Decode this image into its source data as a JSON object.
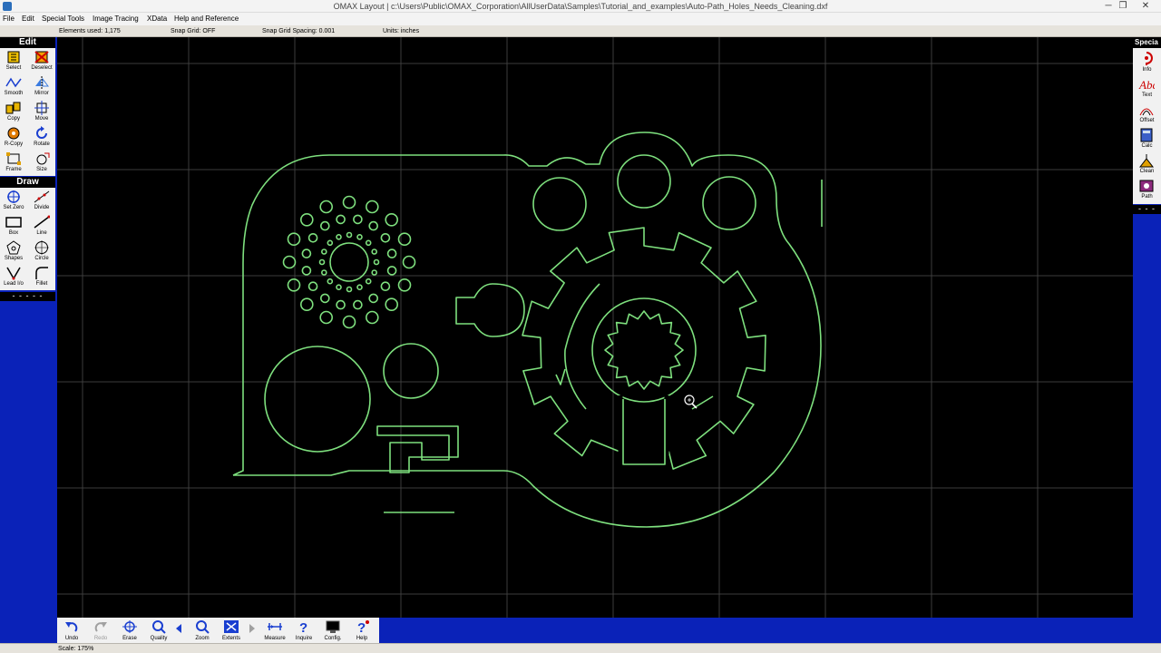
{
  "window": {
    "title": "OMAX Layout | c:\\Users\\Public\\OMAX_Corporation\\AllUserData\\Samples\\Tutorial_and_examples\\Auto-Path_Holes_Needs_Cleaning.dxf",
    "minimize": "─",
    "maximize": "❐",
    "close": "✕"
  },
  "menu": [
    "File",
    "Edit",
    "Special Tools",
    "Image Tracing",
    "XData",
    "Help and Reference"
  ],
  "status": {
    "elements_used": "Elements used: 1,175",
    "snap_grid": "Snap Grid: OFF",
    "snap_spacing": "Snap Grid Spacing: 0.001",
    "units": "Units: inches"
  },
  "edit_palette": {
    "title": "Edit",
    "tools": [
      {
        "label": "Select",
        "icon": "select-icon"
      },
      {
        "label": "Deselect",
        "icon": "deselect-icon"
      },
      {
        "label": "Smooth",
        "icon": "smooth-icon"
      },
      {
        "label": "Mirror",
        "icon": "mirror-icon"
      },
      {
        "label": "Copy",
        "icon": "copy-icon"
      },
      {
        "label": "Move",
        "icon": "move-icon"
      },
      {
        "label": "R-Copy",
        "icon": "rotate-copy-icon"
      },
      {
        "label": "Rotate",
        "icon": "rotate-icon"
      },
      {
        "label": "Frame",
        "icon": "frame-icon"
      },
      {
        "label": "Size",
        "icon": "size-icon"
      }
    ]
  },
  "draw_palette": {
    "title": "Draw",
    "tools": [
      {
        "label": "Set Zero",
        "icon": "set-zero-icon"
      },
      {
        "label": "Divide",
        "icon": "divide-icon"
      },
      {
        "label": "Box",
        "icon": "box-icon"
      },
      {
        "label": "Line",
        "icon": "line-icon"
      },
      {
        "label": "Shapes",
        "icon": "shapes-icon"
      },
      {
        "label": "Circle",
        "icon": "circle-icon"
      },
      {
        "label": "Lead I/o",
        "icon": "lead-io-icon"
      },
      {
        "label": "Fillet",
        "icon": "fillet-icon"
      }
    ],
    "more": "- - - - -"
  },
  "special_palette": {
    "title": "Specia",
    "tools": [
      {
        "label": "Info",
        "icon": "info-icon"
      },
      {
        "label": "Text",
        "icon": "text-icon"
      },
      {
        "label": "Offset",
        "icon": "offset-icon"
      },
      {
        "label": "Calc",
        "icon": "calc-icon"
      },
      {
        "label": "Clean",
        "icon": "clean-icon"
      },
      {
        "label": "Path",
        "icon": "path-icon"
      }
    ],
    "more": "- - -"
  },
  "bottom_tools": [
    {
      "label": "Undo",
      "icon": "undo-icon",
      "enabled": true
    },
    {
      "label": "Redo",
      "icon": "redo-icon",
      "enabled": false
    },
    {
      "label": "Erase",
      "icon": "erase-icon",
      "enabled": true
    },
    {
      "label": "Quality",
      "icon": "quality-icon",
      "enabled": true
    },
    {
      "label": "Zoom",
      "icon": "zoom-icon",
      "enabled": true
    },
    {
      "label": "Extents",
      "icon": "extents-icon",
      "enabled": true
    },
    {
      "label": "Measure",
      "icon": "measure-icon",
      "enabled": true
    },
    {
      "label": "Inquire",
      "icon": "inquire-icon",
      "enabled": true
    },
    {
      "label": "Config.",
      "icon": "config-icon",
      "enabled": true
    },
    {
      "label": "Help",
      "icon": "help-icon",
      "enabled": true
    }
  ],
  "scale_text": "Scale: 175%",
  "colors": {
    "part_stroke": "#7ee07e",
    "grid": "#3d3d3d",
    "canvas": "#000000",
    "panel_blue": "#0a22b8"
  }
}
